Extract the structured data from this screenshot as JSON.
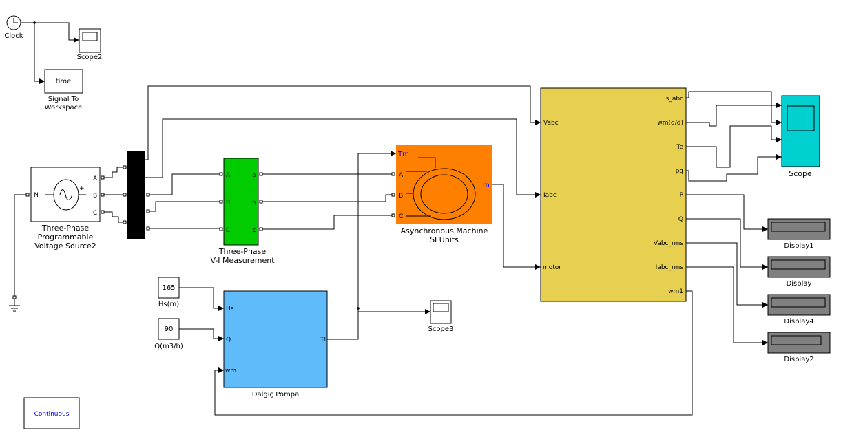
{
  "colors": {
    "vi_measurement": "#00cc00",
    "machine": "#ff8000",
    "pump": "#60bbfb",
    "subsystem": "#e7d050",
    "scope": "#00d0d0",
    "display": "#808080",
    "blue_text": "#0000ff"
  },
  "blocks": {
    "clock": {
      "label": "Clock",
      "icon": "clock-icon"
    },
    "scope2": {
      "label": "Scope2"
    },
    "to_workspace": {
      "variable": "time",
      "label_line1": "Signal To",
      "label_line2": "Workspace"
    },
    "source": {
      "label_line1": "Three-Phase",
      "label_line2": "Programmable",
      "label_line3": "Voltage Source2",
      "ports": {
        "n": "N",
        "a": "A",
        "b": "B",
        "c": "C",
        "plus": "+"
      }
    },
    "vi_measurement": {
      "label_line1": "Three-Phase",
      "label_line2": "V-I Measurement",
      "in_ports": [
        "A",
        "B",
        "C"
      ],
      "out_ports": [
        "a",
        "b",
        "c"
      ]
    },
    "machine": {
      "label_line1": "Asynchronous Machine",
      "label_line2": "SI Units",
      "in_ports": [
        "Tm",
        "A",
        "B",
        "C"
      ],
      "out_port": "m"
    },
    "pump": {
      "label": "Dalgıç Pompa",
      "in_ports": [
        "Hs",
        "Q",
        "wm"
      ],
      "out_port": "Tl"
    },
    "const_hs": {
      "value": "165",
      "label": "Hs(m)"
    },
    "const_q": {
      "value": "90",
      "label": "Q(m3/h)"
    },
    "scope3": {
      "label": "Scope3"
    },
    "subsystem": {
      "in_ports": [
        "Vabc",
        "Iabc",
        "motor"
      ],
      "out_ports": [
        "is_abc",
        "wm(d/d)",
        "Te",
        "pq",
        "P",
        "Q",
        "Vabc_rms",
        "Iabc_rms",
        "wm1"
      ]
    },
    "scope": {
      "label": "Scope"
    },
    "displays": [
      "Display1",
      "Display",
      "Display4",
      "Display2"
    ],
    "powergui": {
      "label": "Continuous"
    }
  }
}
